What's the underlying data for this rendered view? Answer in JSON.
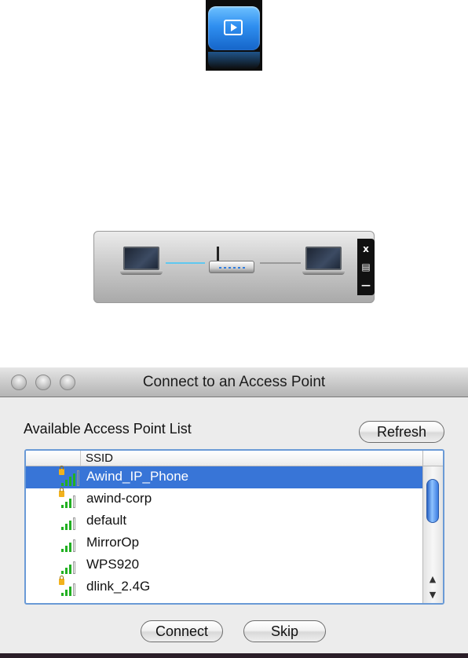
{
  "app_icon": {
    "name": "app-icon"
  },
  "connection_widget": {
    "link_status": [
      "connected",
      "connected"
    ],
    "controls": [
      {
        "name": "close-icon",
        "glyph": "x"
      },
      {
        "name": "menu-icon",
        "glyph": "▤"
      },
      {
        "name": "minimize-icon",
        "glyph": "—"
      }
    ],
    "colors": {
      "active_link": "#5fc8f0",
      "inactive_link": "#9a9a9a"
    }
  },
  "window": {
    "title": "Connect to an Access Point",
    "list_label": "Available Access Point List",
    "refresh_label": "Refresh",
    "table": {
      "header": "SSID",
      "rows": [
        {
          "ssid": "Awind_IP_Phone",
          "locked": true,
          "selected": true
        },
        {
          "ssid": "awind-corp",
          "locked": true,
          "selected": false
        },
        {
          "ssid": "default",
          "locked": false,
          "selected": false
        },
        {
          "ssid": "MirrorOp",
          "locked": false,
          "selected": false
        },
        {
          "ssid": "WPS920",
          "locked": false,
          "selected": false
        },
        {
          "ssid": "dlink_2.4G",
          "locked": true,
          "selected": false
        }
      ],
      "scroll_up": "▲",
      "scroll_down": "▼"
    },
    "connect_label": "Connect",
    "skip_label": "Skip",
    "colors": {
      "selection": "#3875d7",
      "signal": "#22b022"
    }
  }
}
